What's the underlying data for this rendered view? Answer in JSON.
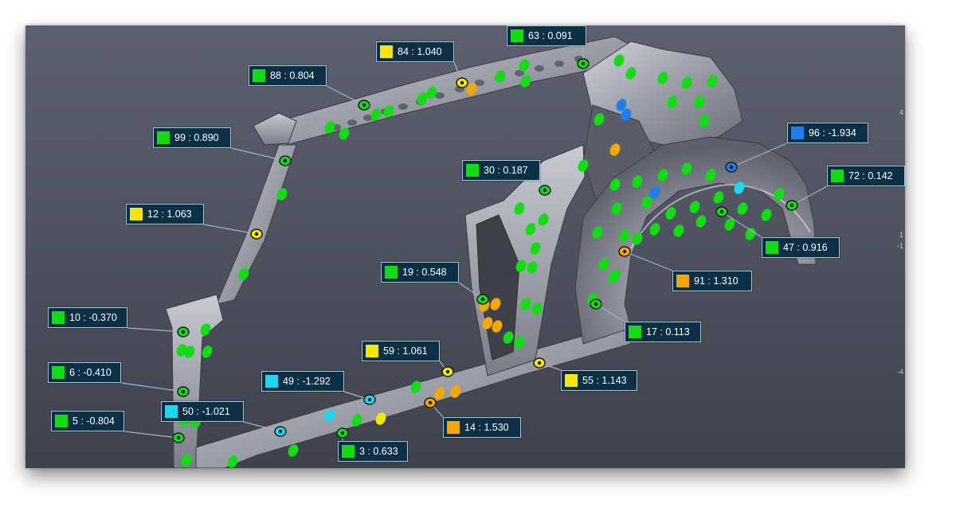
{
  "colors": {
    "green": "#12dd12",
    "yellow": "#f6e600",
    "orange": "#f6a800",
    "cyan": "#19d8f2",
    "blue": "#1e7ef0",
    "callout_bg": "#0b2f45",
    "callout_border": "#a9c4d3",
    "viewport_bg": "#545765"
  },
  "callouts": [
    {
      "id": "63",
      "text": "63 : 0.091",
      "color": "#12dd12"
    },
    {
      "id": "84",
      "text": "84 : 1.040",
      "color": "#f6e600"
    },
    {
      "id": "88",
      "text": "88 : 0.804",
      "color": "#12dd12"
    },
    {
      "id": "99",
      "text": "99 : 0.890",
      "color": "#12dd12"
    },
    {
      "id": "96",
      "text": "96 : -1.934",
      "color": "#1e7ef0"
    },
    {
      "id": "30",
      "text": "30 : 0.187",
      "color": "#12dd12"
    },
    {
      "id": "72",
      "text": "72 : 0.142",
      "color": "#12dd12"
    },
    {
      "id": "12",
      "text": "12 : 1.063",
      "color": "#f6e600"
    },
    {
      "id": "47",
      "text": "47 : 0.916",
      "color": "#12dd12"
    },
    {
      "id": "19",
      "text": "19 : 0.548",
      "color": "#12dd12"
    },
    {
      "id": "91",
      "text": "91 : 1.310",
      "color": "#f6a800"
    },
    {
      "id": "10",
      "text": "10 : -0.370",
      "color": "#12dd12"
    },
    {
      "id": "17",
      "text": "17 : 0.113",
      "color": "#12dd12"
    },
    {
      "id": "59",
      "text": "59 : 1.061",
      "color": "#f6e600"
    },
    {
      "id": "6",
      "text": "6 : -0.410",
      "color": "#12dd12"
    },
    {
      "id": "49",
      "text": "49 : -1.292",
      "color": "#19d8f2"
    },
    {
      "id": "55",
      "text": "55 : 1.143",
      "color": "#f6e600"
    },
    {
      "id": "50",
      "text": "50 : -1.021",
      "color": "#19d8f2"
    },
    {
      "id": "5",
      "text": "5 : -0.804",
      "color": "#12dd12"
    },
    {
      "id": "14",
      "text": "14 : 1.530",
      "color": "#f6a800"
    },
    {
      "id": "3",
      "text": "3 : 0.633",
      "color": "#12dd12"
    }
  ],
  "edge_ticks": [
    "4",
    "1",
    "-1",
    "-4"
  ]
}
